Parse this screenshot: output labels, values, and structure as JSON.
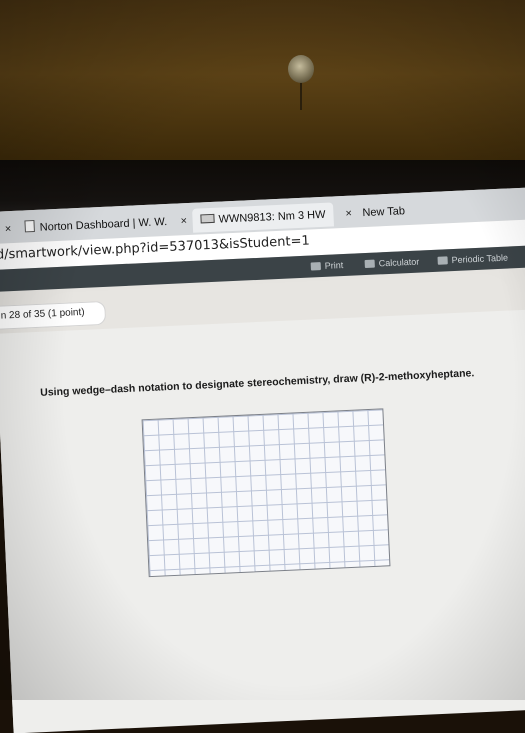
{
  "tabs": [
    {
      "label": "",
      "icon": "close-icon"
    },
    {
      "label": "Norton Dashboard | W. W.",
      "icon": "document-icon"
    },
    {
      "label": "WWN9813: Nm 3 HW",
      "icon": "wwnorton-icon"
    },
    {
      "label": "New Tab"
    }
  ],
  "address": {
    "url": "d/smartwork/view.php?id=537013&isStudent=1"
  },
  "toolbar": {
    "print_label": "Print",
    "calculator_label": "Calculator",
    "periodic_table_label": "Periodic Table"
  },
  "question": {
    "header": "n 28 of 35 (1 point)",
    "prompt": "Using wedge–dash notation to designate stereochemistry, draw (R)-2-methoxyheptane."
  },
  "colors": {
    "toolbar_bg": "#3b4347",
    "grid_line": "#b9c2d6",
    "page_bg": "#eeeeec"
  }
}
